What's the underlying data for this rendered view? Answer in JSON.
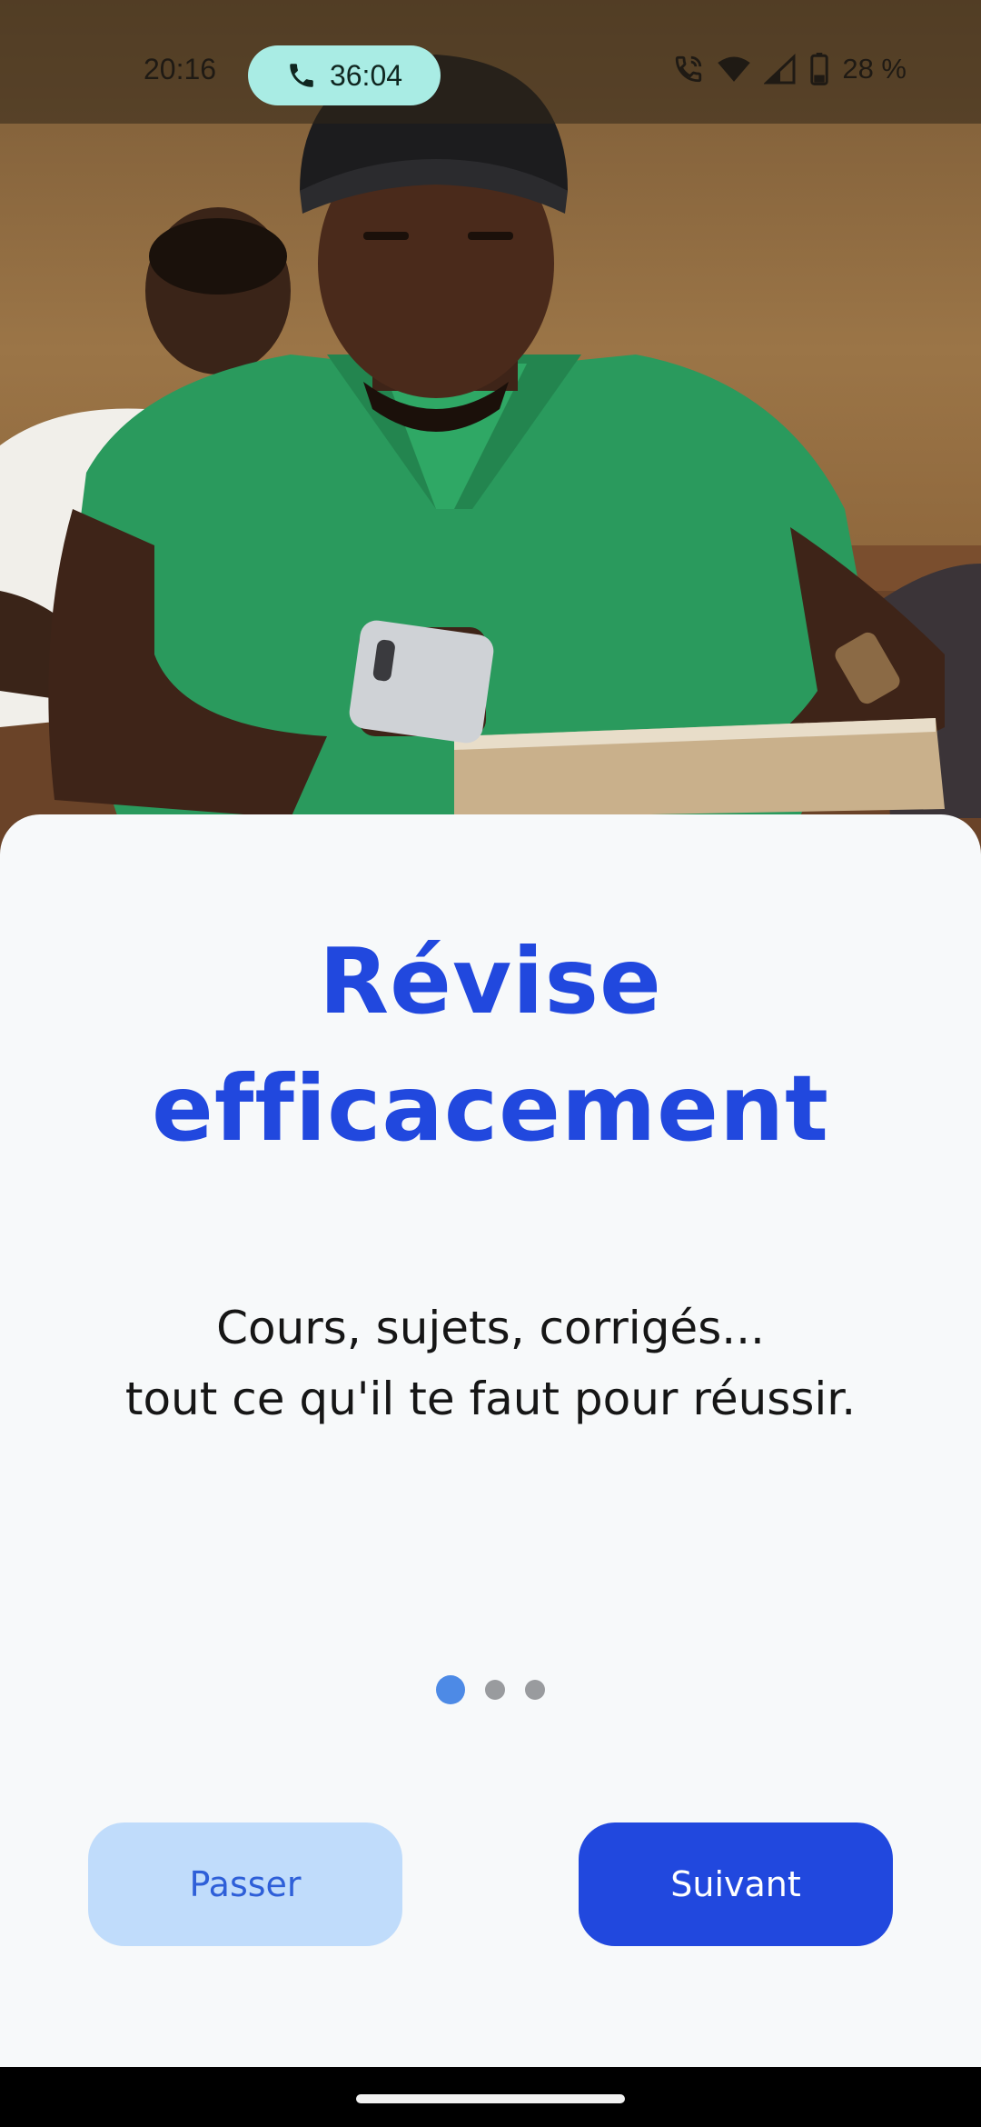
{
  "status_bar": {
    "time": "20:16",
    "call_timer": "36:04",
    "battery_percent": "28 %",
    "icons": [
      "phone-icon",
      "call-wifi-icon",
      "wifi-icon",
      "cell-signal-icon",
      "battery-icon"
    ]
  },
  "hero": {
    "image": "student-green-polo-reading-phone"
  },
  "onboarding": {
    "title_line1": "Révise",
    "title_line2": "efficacement",
    "subtitle_line1": "Cours, sujets, corrigés...",
    "subtitle_line2": "tout ce qu'il te faut pour réussir.",
    "page_count": 3,
    "active_page": 1,
    "skip_label": "Passer",
    "next_label": "Suivant"
  },
  "colors": {
    "accent": "#2148de",
    "skip_bg": "#c0dcfb",
    "dot_active": "#4d8ae6",
    "dot_inactive": "#999b9e",
    "sheet_bg": "#f7f9fa",
    "call_pill": "#a9ece4"
  }
}
